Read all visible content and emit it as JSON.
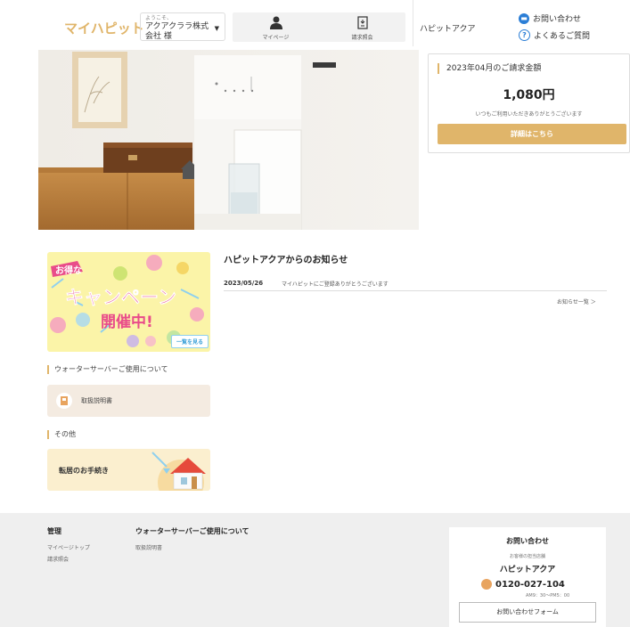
{
  "header": {
    "logo": "マイハピット",
    "user": {
      "welcome": "ようこそ、",
      "company_line1": "アクアクララ株式",
      "company_line2": "会社 様"
    },
    "nav": [
      {
        "label": "マイページ",
        "icon": "person-icon"
      },
      {
        "label": "請求照会",
        "icon": "invoice-icon"
      }
    ],
    "brand": "ハピットアクア",
    "contact": "お問い合わせ",
    "faq": "よくあるご質問"
  },
  "billing": {
    "title": "2023年04月のご請求金額",
    "amount": "1,080円",
    "thanks": "いつもご利用いただきありがとうございます",
    "details_button": "詳細はこちら"
  },
  "campaign": {
    "tag": "お得な",
    "line1": "キャンペーン",
    "line2": "開催中!",
    "button": "一覧を見る"
  },
  "news": {
    "title": "ハピットアクアからのお知らせ",
    "items": [
      {
        "date": "2023/05/26",
        "text": "マイハピットにご登録ありがとうございます"
      }
    ],
    "more": "お知らせ一覧 ＞"
  },
  "sections": {
    "water_server": "ウォーターサーバーご使用について",
    "manual": "取扱説明書",
    "other": "その他",
    "moving": "転居のお手続き"
  },
  "footer": {
    "col1": {
      "title": "管理",
      "links": [
        "マイページトップ",
        "請求照会"
      ]
    },
    "col2": {
      "title": "ウォーターサーバーご使用について",
      "links": [
        "取扱説明書"
      ]
    },
    "contact_card": {
      "title": "お問い合わせ",
      "subtitle": "お客様の担当店舗",
      "brand": "ハピットアクア",
      "phone": "0120-027-104",
      "hours": "AM9：30～PM5：00",
      "form_button": "お問い合わせフォーム"
    }
  },
  "colors": {
    "accent": "#e0b56a",
    "link_blue": "#2b7ed6",
    "footer_bg": "#efefef"
  }
}
